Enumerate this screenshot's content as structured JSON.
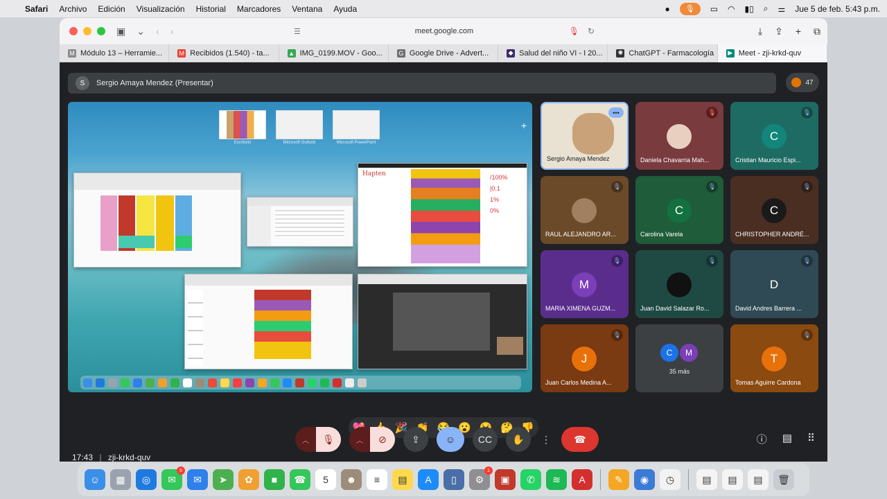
{
  "menubar": {
    "app": "Safari",
    "items": [
      "Archivo",
      "Edición",
      "Visualización",
      "Historial",
      "Marcadores",
      "Ventana",
      "Ayuda"
    ],
    "datetime": "Jue 5 de feb. 5:43 p.m."
  },
  "browser": {
    "url": "meet.google.com",
    "tabs": [
      {
        "title": "Módulo 13 – Herramie...",
        "color": "#8a8a8a",
        "glyph": "M"
      },
      {
        "title": "Recibidos (1.540) - ta...",
        "color": "#ea4335",
        "glyph": "M"
      },
      {
        "title": "IMG_0199.MOV - Goo...",
        "color": "#34a853",
        "glyph": "▲"
      },
      {
        "title": "Google Drive - Advert...",
        "color": "#6f6f6f",
        "glyph": "G"
      },
      {
        "title": "Salud del niño VI - I 20...",
        "color": "#3b2a6b",
        "glyph": "◆"
      },
      {
        "title": "ChatGPT - Farmacología",
        "color": "#333333",
        "glyph": "✺"
      },
      {
        "title": "Meet - zji-krkd-quv",
        "color": "#00897b",
        "glyph": "▶"
      }
    ]
  },
  "meet": {
    "presenter_label": "Sergio Amaya Mendez (Presentar)",
    "presenter_initial": "S",
    "participant_count": "47",
    "clock": "17:43",
    "meeting_code": "zji-krkd-quv",
    "more_label": "35 más",
    "spaces": [
      "Escritorio",
      "Microsoft Outlook",
      "Microsoft PowerPoint"
    ],
    "reactions": [
      "💖",
      "👍",
      "🎉",
      "👏",
      "😂",
      "😮",
      "😢",
      "🤔",
      "👎"
    ]
  },
  "tiles": [
    {
      "name": "Sergio Amaya Mendez",
      "initial": "",
      "bg": "#e9e1d2",
      "avatar_bg": "#c9a27a",
      "muted": false,
      "self": true
    },
    {
      "name": "Daniela Chavarria Mah...",
      "initial": "",
      "bg": "#7a3b3e",
      "avatar_bg": "#e8cfc0",
      "muted": true,
      "red": true
    },
    {
      "name": "Cristian Mauricio Espi...",
      "initial": "C",
      "bg": "#1e6b64",
      "avatar_bg": "#12867a",
      "muted": true
    },
    {
      "name": "RAUL ALEJANDRO AR...",
      "initial": "",
      "bg": "#6b4a2a",
      "avatar_bg": "#a08060",
      "muted": true
    },
    {
      "name": "Carolina Varela",
      "initial": "C",
      "bg": "#1f5c3a",
      "avatar_bg": "#13703f",
      "muted": true
    },
    {
      "name": "CHRISTOPHER ANDRÉ...",
      "initial": "C",
      "bg": "#4a2e22",
      "avatar_bg": "#1a1a1a",
      "muted": true
    },
    {
      "name": "MARIA XIMENA GUZM...",
      "initial": "M",
      "bg": "#5a2d8c",
      "avatar_bg": "#7b3fb8",
      "muted": true
    },
    {
      "name": "Juan David Salazar Ro...",
      "initial": "",
      "bg": "#1f4a44",
      "avatar_bg": "#111111",
      "muted": true
    },
    {
      "name": "David Andres Barrera ...",
      "initial": "D",
      "bg": "#2f4a55",
      "avatar_bg": "#2f4a55",
      "muted": true
    },
    {
      "name": "Juan Carlos Medina A...",
      "initial": "J",
      "bg": "#7a3a12",
      "avatar_bg": "#e8710a",
      "muted": true
    },
    {
      "name": "",
      "initial": "",
      "bg": "#3c4043",
      "avatar_bg": "#3c4043",
      "muted": false,
      "more": true
    },
    {
      "name": "Tomas Aguirre Cardona",
      "initial": "T",
      "bg": "#8a4a10",
      "avatar_bg": "#e8710a",
      "muted": true
    }
  ],
  "more_avatars": [
    "C",
    "M"
  ],
  "dock": {
    "apps": [
      {
        "name": "finder",
        "color": "#3b8fe8",
        "glyph": "☺"
      },
      {
        "name": "launchpad",
        "color": "#9aa3ad",
        "glyph": "▦"
      },
      {
        "name": "safari",
        "color": "#1f7ae0",
        "glyph": "◎"
      },
      {
        "name": "messages",
        "color": "#34c759",
        "glyph": "✉",
        "badge": "5"
      },
      {
        "name": "mail",
        "color": "#2f80ed",
        "glyph": "✉"
      },
      {
        "name": "maps",
        "color": "#4cb050",
        "glyph": "➤"
      },
      {
        "name": "photos",
        "color": "#f0a030",
        "glyph": "✿"
      },
      {
        "name": "facetime",
        "color": "#2fb34a",
        "glyph": "■"
      },
      {
        "name": "phone",
        "color": "#34c759",
        "glyph": "☎"
      },
      {
        "name": "calendar",
        "color": "#ffffff",
        "glyph": "5"
      },
      {
        "name": "contacts",
        "color": "#9c8c7a",
        "glyph": "☻"
      },
      {
        "name": "reminders",
        "color": "#ffffff",
        "glyph": "≡"
      },
      {
        "name": "notes",
        "color": "#ffd84d",
        "glyph": "▤"
      },
      {
        "name": "app-store",
        "color": "#1d8cf8",
        "glyph": "A"
      },
      {
        "name": "iphone-mirroring",
        "color": "#4a6ea8",
        "glyph": "▯"
      },
      {
        "name": "system-settings",
        "color": "#8e8e93",
        "glyph": "⚙",
        "badge": "1"
      },
      {
        "name": "photo-booth",
        "color": "#c0392b",
        "glyph": "▣"
      },
      {
        "name": "whatsapp",
        "color": "#25d366",
        "glyph": "✆"
      },
      {
        "name": "spotify",
        "color": "#1db954",
        "glyph": "≋"
      },
      {
        "name": "acrobat",
        "color": "#d32f2f",
        "glyph": "A"
      },
      {
        "name": "pages",
        "color": "#f5a623",
        "glyph": "✎"
      },
      {
        "name": "mirror-app",
        "color": "#3a7bd5",
        "glyph": "◉"
      },
      {
        "name": "clock",
        "color": "#f2f2f2",
        "glyph": "◷"
      },
      {
        "name": "doc-1",
        "color": "#f4f4f4",
        "glyph": "▤"
      },
      {
        "name": "doc-2",
        "color": "#f4f4f4",
        "glyph": "▤"
      },
      {
        "name": "doc-3",
        "color": "#f4f4f4",
        "glyph": "▤"
      },
      {
        "name": "trash",
        "color": "#c8ccd2",
        "glyph": "🗑"
      }
    ]
  }
}
